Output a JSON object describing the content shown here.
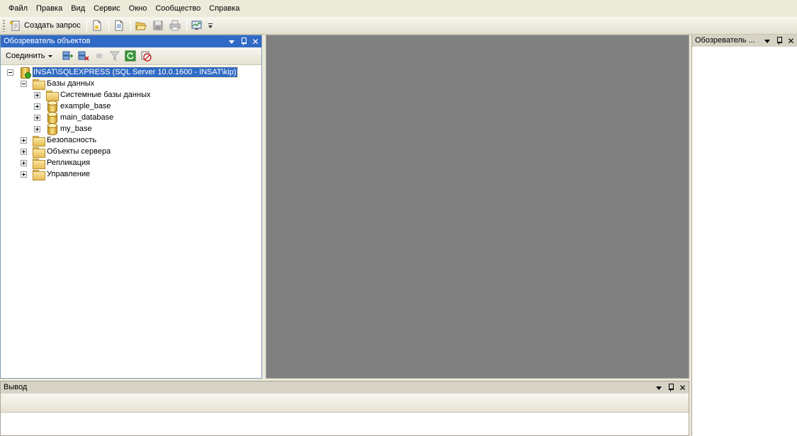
{
  "menu": [
    "Файл",
    "Правка",
    "Вид",
    "Сервис",
    "Окно",
    "Сообщество",
    "Справка"
  ],
  "toolbar": {
    "new_query_label": "Создать запрос",
    "icons": [
      "new-query-icon",
      "new-file-icon",
      "new-project-icon",
      "open-file-icon",
      "save-icon",
      "print-icon",
      "activity-monitor-icon",
      "toolbar-options-icon"
    ]
  },
  "object_explorer": {
    "title": "Обозреватель объектов",
    "connect_label": "Соединить",
    "server": "INSAT\\SQLEXPRESS (SQL Server 10.0.1600 - INSAT\\kip)",
    "databases_folder": "Базы данных",
    "system_databases": "Системные базы данных",
    "databases": [
      "example_base",
      "main_database",
      "my_base"
    ],
    "folders": [
      "Безопасность",
      "Объекты сервера",
      "Репликация",
      "Управление"
    ]
  },
  "right_panel": {
    "title": "Обозреватель ..."
  },
  "output_panel": {
    "title": "Вывод"
  },
  "colors": {
    "active_header": "#316ac5",
    "document_area": "#808080",
    "chrome": "#ece9d8"
  }
}
